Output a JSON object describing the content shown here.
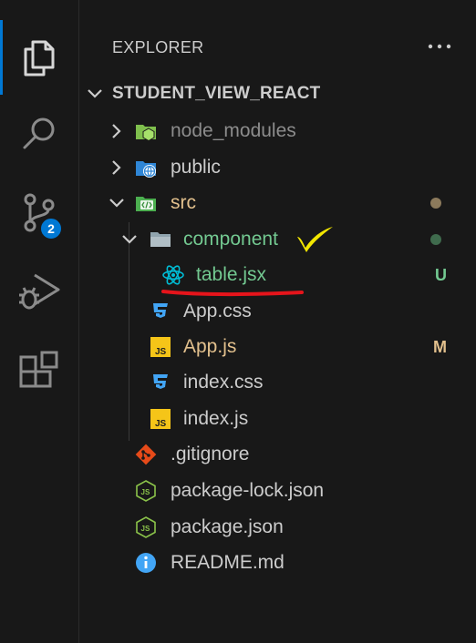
{
  "activity_bar": {
    "items": [
      {
        "name": "explorer",
        "icon": "files-icon"
      },
      {
        "name": "search",
        "icon": "search-icon"
      },
      {
        "name": "source-control",
        "icon": "source-control-icon",
        "badge": "2"
      },
      {
        "name": "run-debug",
        "icon": "run-debug-icon"
      },
      {
        "name": "extensions",
        "icon": "extensions-icon"
      }
    ]
  },
  "explorer": {
    "title": "EXPLORER",
    "more_actions": "···",
    "root": "STUDENT_VIEW_REACT",
    "tree": [
      {
        "label": "node_modules",
        "type": "folder",
        "icon": "node-folder-icon"
      },
      {
        "label": "public",
        "type": "folder",
        "icon": "public-folder-icon"
      },
      {
        "label": "src",
        "type": "folder",
        "icon": "src-folder-icon"
      },
      {
        "label": "component",
        "type": "folder",
        "icon": "folder-icon"
      },
      {
        "label": "table.jsx",
        "type": "file",
        "icon": "react-icon",
        "status": "U"
      },
      {
        "label": "App.css",
        "type": "file",
        "icon": "css-icon"
      },
      {
        "label": "App.js",
        "type": "file",
        "icon": "js-icon",
        "status": "M"
      },
      {
        "label": "index.css",
        "type": "file",
        "icon": "css-icon"
      },
      {
        "label": "index.js",
        "type": "file",
        "icon": "js-icon"
      },
      {
        "label": ".gitignore",
        "type": "file",
        "icon": "git-icon"
      },
      {
        "label": "package-lock.json",
        "type": "file",
        "icon": "node-json-icon"
      },
      {
        "label": "package.json",
        "type": "file",
        "icon": "node-json-icon"
      },
      {
        "label": "README.md",
        "type": "file",
        "icon": "info-icon"
      }
    ]
  },
  "colors": {
    "untracked": "#73c991",
    "modified": "#e2c08d",
    "ignored": "#8c8c8c",
    "accent": "#0078d4",
    "annotation_check": "#f2e600",
    "annotation_underline": "#e5141b"
  }
}
